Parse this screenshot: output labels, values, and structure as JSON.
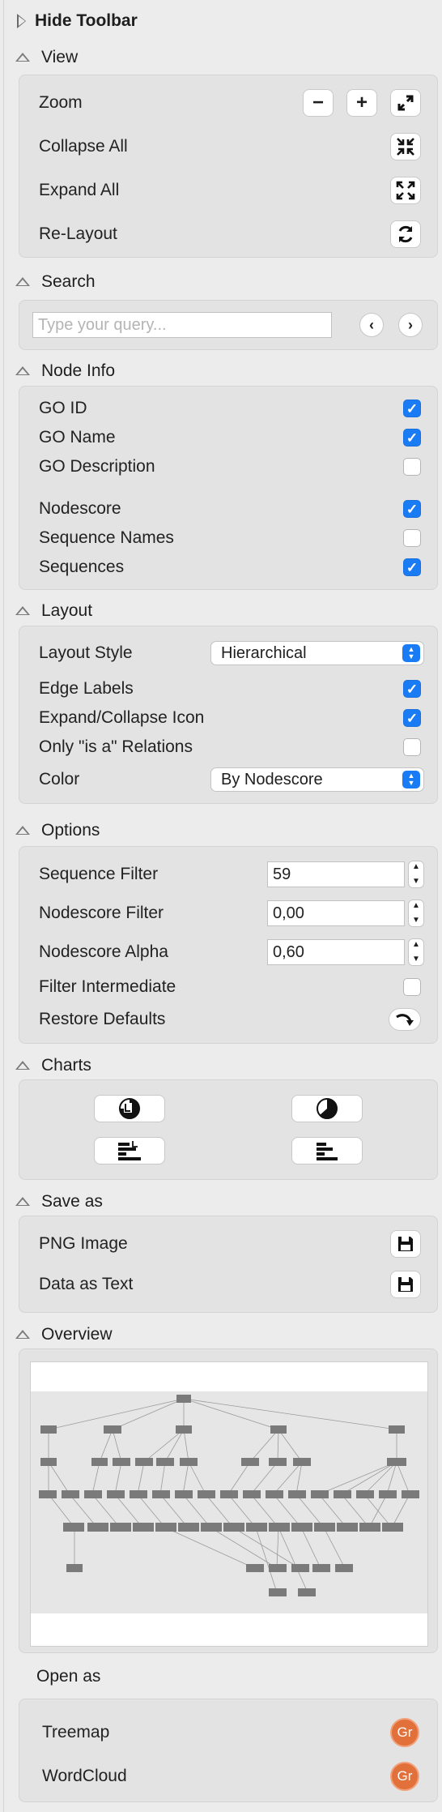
{
  "toolbar": {
    "title": "Hide Toolbar"
  },
  "view": {
    "title": "View",
    "zoom_label": "Zoom",
    "zoom_out": "−",
    "zoom_in": "+",
    "collapse_label": "Collapse All",
    "expand_label": "Expand All",
    "relayout_label": "Re-Layout"
  },
  "search": {
    "title": "Search",
    "placeholder": "Type your query...",
    "prev": "‹",
    "next": "›"
  },
  "node_info": {
    "title": "Node Info",
    "items": [
      {
        "label": "GO ID",
        "checked": true
      },
      {
        "label": "GO Name",
        "checked": true
      },
      {
        "label": "GO Description",
        "checked": false
      },
      {
        "label": "Nodescore",
        "checked": true
      },
      {
        "label": "Sequence Names",
        "checked": false
      },
      {
        "label": "Sequences",
        "checked": true
      }
    ]
  },
  "layout": {
    "title": "Layout",
    "style_label": "Layout Style",
    "style_value": "Hierarchical",
    "edge_labels": "Edge Labels",
    "edge_labels_checked": true,
    "expand_icon": "Expand/Collapse Icon",
    "expand_icon_checked": true,
    "isa_only": "Only \"is a\" Relations",
    "isa_only_checked": false,
    "color_label": "Color",
    "color_value": "By Nodescore"
  },
  "options": {
    "title": "Options",
    "seq_filter_label": "Sequence Filter",
    "seq_filter_value": "59",
    "node_filter_label": "Nodescore Filter",
    "node_filter_value": "0,00",
    "node_alpha_label": "Nodescore Alpha",
    "node_alpha_value": "0,60",
    "filter_intermediate": "Filter Intermediate",
    "filter_intermediate_checked": false,
    "restore_defaults": "Restore Defaults"
  },
  "charts": {
    "title": "Charts"
  },
  "save_as": {
    "title": "Save as",
    "png_label": "PNG Image",
    "text_label": "Data as Text"
  },
  "overview": {
    "title": "Overview"
  },
  "open_as": {
    "title": "Open as",
    "treemap_label": "Treemap",
    "wordcloud_label": "WordCloud",
    "icon_text": "Gr"
  },
  "colors": {
    "accent": "#1a7cf4",
    "open_icon": "#e2703a"
  }
}
